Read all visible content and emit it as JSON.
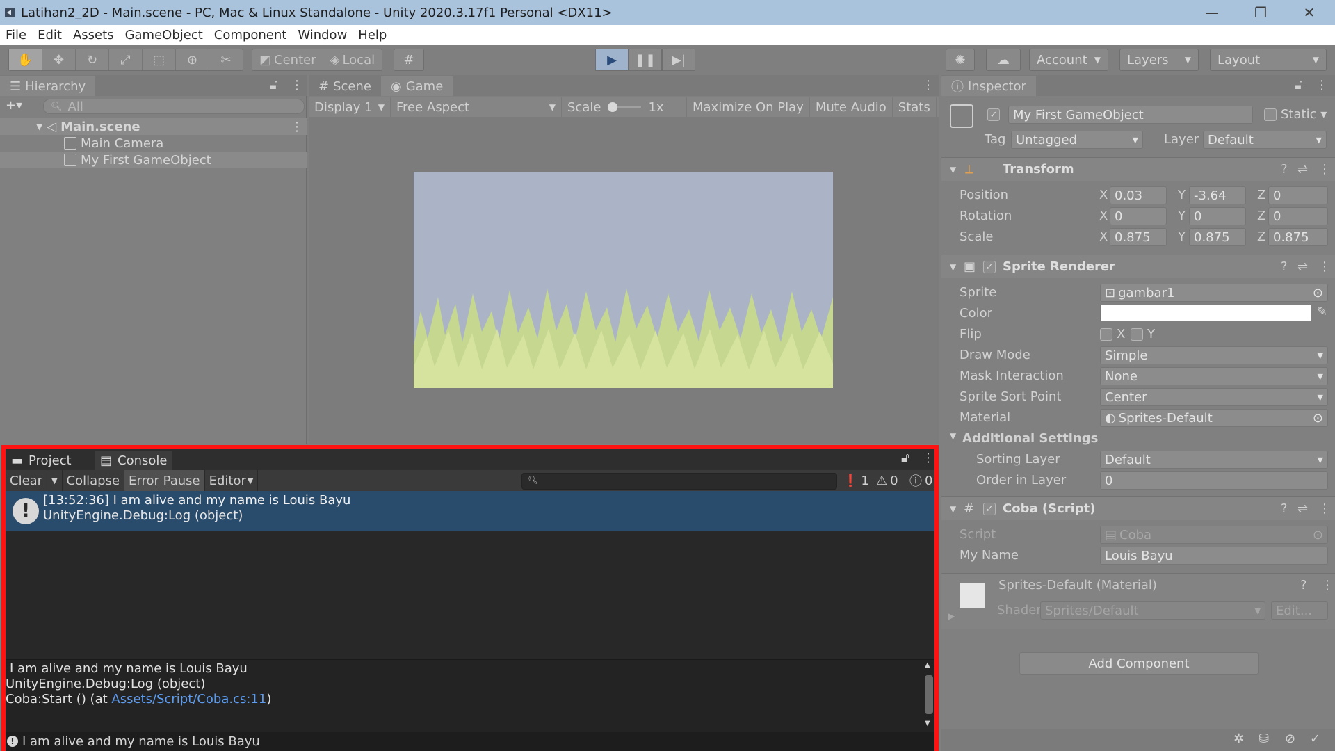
{
  "window": {
    "title": "Latihan2_2D - Main.scene - PC, Mac & Linux Standalone - Unity 2020.3.17f1 Personal <DX11>",
    "minimize": "—",
    "restore": "❐",
    "close": "✕"
  },
  "menu": [
    "File",
    "Edit",
    "Assets",
    "GameObject",
    "Component",
    "Window",
    "Help"
  ],
  "toolbar": {
    "pivot_label": "Center",
    "space_label": "Local",
    "account_label": "Account",
    "layers_label": "Layers",
    "layout_label": "Layout"
  },
  "hierarchy": {
    "tab_label": "Hierarchy",
    "search_placeholder": "All",
    "scene_name": "Main.scene",
    "items": [
      "Main Camera",
      "My First GameObject"
    ]
  },
  "scene_view": {
    "tabs": [
      "Scene",
      "Game"
    ],
    "display": "Display 1",
    "aspect": "Free Aspect",
    "scale_label": "Scale",
    "scale_value": "1x",
    "maximize": "Maximize On Play",
    "mute": "Mute Audio",
    "stats": "Stats"
  },
  "inspector": {
    "tab_label": "Inspector",
    "object_name": "My First GameObject",
    "static_label": "Static",
    "tag_label": "Tag",
    "tag_value": "Untagged",
    "layer_label": "Layer",
    "layer_value": "Default",
    "transform": {
      "title": "Transform",
      "position_label": "Position",
      "rotation_label": "Rotation",
      "scale_label": "Scale",
      "position": {
        "x": "0.03",
        "y": "-3.64",
        "z": "0"
      },
      "rotation": {
        "x": "0",
        "y": "0",
        "z": "0"
      },
      "scale": {
        "x": "0.875",
        "y": "0.875",
        "z": "0.875"
      }
    },
    "sprite_renderer": {
      "title": "Sprite Renderer",
      "sprite_label": "Sprite",
      "sprite_value": "gambar1",
      "color_label": "Color",
      "color_value": "#ffffff",
      "flip_label": "Flip",
      "flip_x": "X",
      "flip_y": "Y",
      "draw_mode_label": "Draw Mode",
      "draw_mode_value": "Simple",
      "mask_label": "Mask Interaction",
      "mask_value": "None",
      "sort_point_label": "Sprite Sort Point",
      "sort_point_value": "Center",
      "material_label": "Material",
      "material_value": "Sprites-Default",
      "additional_label": "Additional Settings",
      "sorting_layer_label": "Sorting Layer",
      "sorting_layer_value": "Default",
      "order_label": "Order in Layer",
      "order_value": "0"
    },
    "script": {
      "title": "Coba (Script)",
      "script_label": "Script",
      "script_value": "Coba",
      "myname_label": "My Name",
      "myname_value": "Louis Bayu"
    },
    "material": {
      "title": "Sprites-Default (Material)",
      "shader_label": "Shader",
      "shader_value": "Sprites/Default",
      "edit_label": "Edit..."
    },
    "add_component": "Add Component"
  },
  "console": {
    "tab_project": "Project",
    "tab_console": "Console",
    "clear": "Clear",
    "collapse": "Collapse",
    "error_pause": "Error Pause",
    "editor": "Editor",
    "count_errors": "1",
    "count_warnings": "0",
    "count_messages": "0",
    "entry_line1": "[13:52:36] I am alive and my name is Louis Bayu",
    "entry_line2": "UnityEngine.Debug:Log (object)",
    "detail_line1": "I am alive and my name is Louis Bayu",
    "detail_line2": "UnityEngine.Debug:Log (object)",
    "detail_line3_prefix": "Coba:Start () (at ",
    "detail_link": "Assets/Script/Coba.cs:11",
    "detail_line3_suffix": ")",
    "status_text": "I am alive and my name is Louis Bayu"
  },
  "colors": {
    "selection": "#294b6c",
    "highlight_border": "#ff1212",
    "link": "#5b9bf0"
  }
}
